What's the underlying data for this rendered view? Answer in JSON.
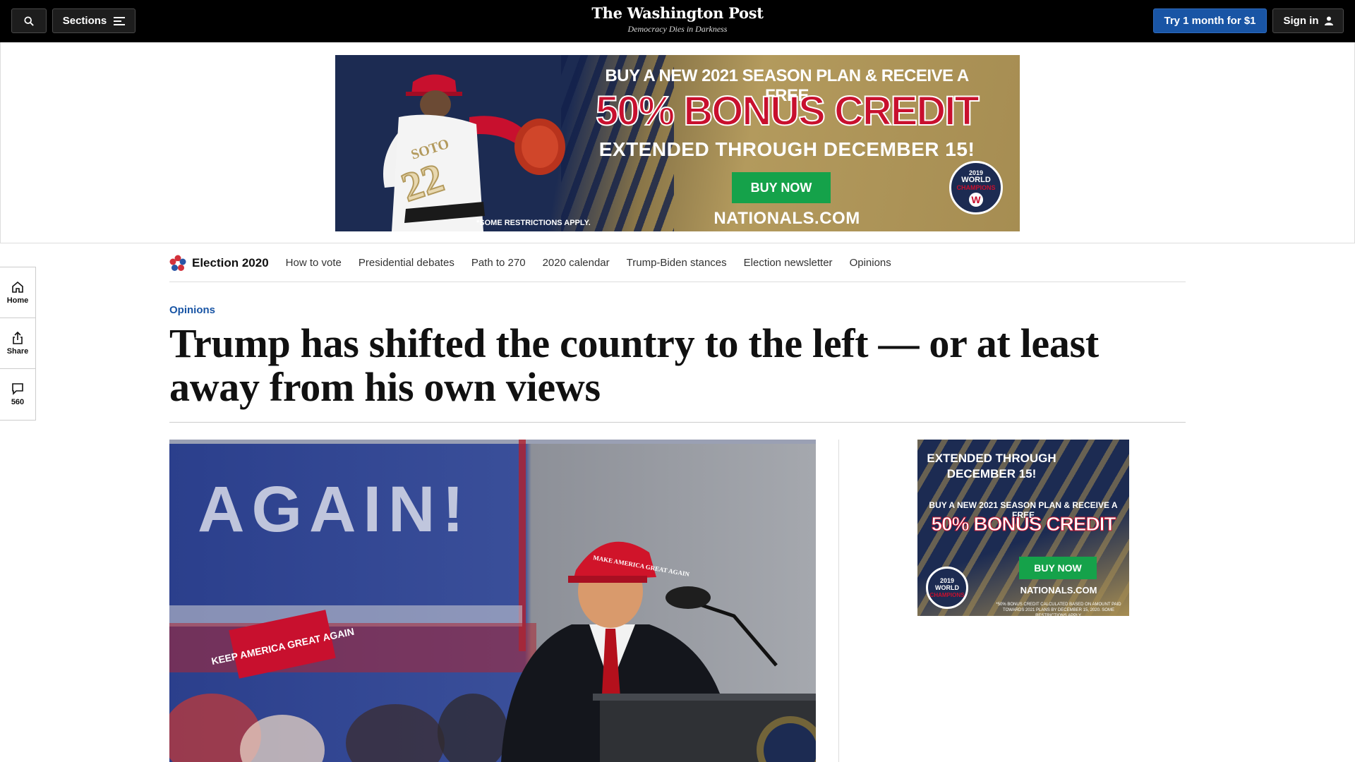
{
  "topbar": {
    "sections_label": "Sections",
    "logo": "The Washington Post",
    "tagline": "Democracy Dies in Darkness",
    "trial_label": "Try 1 month for $1",
    "signin_label": "Sign in"
  },
  "top_ad": {
    "line1": "BUY A NEW 2021 SEASON PLAN & RECEIVE A FREE",
    "line2": "50% BONUS CREDIT",
    "line3": "EXTENDED THROUGH DECEMBER 15!",
    "button": "BUY NOW",
    "restrictions": "*SOME RESTRICTIONS APPLY.",
    "site": "NATIONALS.COM",
    "seal_year": "2019",
    "seal_line1": "WORLD",
    "seal_line2": "CHAMPIONS",
    "jersey_name": "SOTO",
    "jersey_number": "22"
  },
  "rail": {
    "home_label": "Home",
    "share_label": "Share",
    "comments_count": "560"
  },
  "section_nav": {
    "title": "Election 2020",
    "links": [
      "How to vote",
      "Presidential debates",
      "Path to 270",
      "2020 calendar",
      "Trump-Biden stances",
      "Election newsletter",
      "Opinions"
    ]
  },
  "article": {
    "kicker": "Opinions",
    "headline": "Trump has shifted the country to the left — or at least away from his own views"
  },
  "photo": {
    "banner_text": "AGAIN!",
    "hat_text": "MAKE AMERICA GREAT AGAIN",
    "sign_text": "KEEP AMERICA GREAT AGAIN"
  },
  "side_ad": {
    "line1": "EXTENDED THROUGH DECEMBER 15!",
    "line2": "BUY A NEW 2021 SEASON PLAN & RECEIVE A FREE",
    "line3": "50% BONUS CREDIT",
    "button": "BUY NOW",
    "site": "NATIONALS.COM",
    "fine_print": "*50% BONUS CREDIT CALCULATED BASED ON AMOUNT PAID TOWARDS 2021 PLANS BY DECEMBER 15, 2020. SOME RESTRICTIONS APPLY.",
    "seal_year": "2019",
    "seal_line1": "WORLD",
    "seal_line2": "CHAMPIONS"
  }
}
